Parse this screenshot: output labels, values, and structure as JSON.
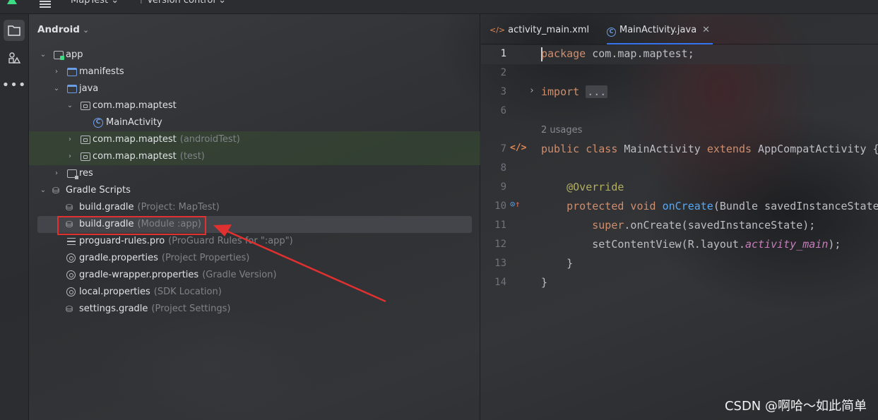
{
  "toolbar": {
    "project_name": "MapTest",
    "vcs_label": "Version control"
  },
  "project_panel": {
    "view_label": "Android",
    "tree": [
      {
        "label": "app",
        "hint": ""
      },
      {
        "label": "manifests",
        "hint": ""
      },
      {
        "label": "java",
        "hint": ""
      },
      {
        "label": "com.map.maptest",
        "hint": ""
      },
      {
        "label": "MainActivity",
        "hint": ""
      },
      {
        "label": "com.map.maptest",
        "hint": "(androidTest)"
      },
      {
        "label": "com.map.maptest",
        "hint": "(test)"
      },
      {
        "label": "res",
        "hint": ""
      },
      {
        "label": "Gradle Scripts",
        "hint": ""
      },
      {
        "label": "build.gradle",
        "hint": "(Project: MapTest)"
      },
      {
        "label": "build.gradle",
        "hint": "(Module :app)"
      },
      {
        "label": "proguard-rules.pro",
        "hint": "(ProGuard Rules for \":app\")"
      },
      {
        "label": "gradle.properties",
        "hint": "(Project Properties)"
      },
      {
        "label": "gradle-wrapper.properties",
        "hint": "(Gradle Version)"
      },
      {
        "label": "local.properties",
        "hint": "(SDK Location)"
      },
      {
        "label": "settings.gradle",
        "hint": "(Project Settings)"
      }
    ]
  },
  "editor": {
    "tabs": [
      {
        "label": "activity_main.xml"
      },
      {
        "label": "MainActivity.java"
      }
    ],
    "line_numbers": [
      "1",
      "2",
      "3",
      "6",
      "7",
      "8",
      "9",
      "10",
      "11",
      "12",
      "13",
      "14"
    ],
    "usages": "2 usages",
    "code": {
      "l1_kw": "package",
      "l1_rest": " com.map.maptest;",
      "l3_kw": "import",
      "l3_fold": "...",
      "l7_kw1": "public class",
      "l7_name": " MainActivity ",
      "l7_kw2": "extends",
      "l7_rest": " AppCompatActivity {",
      "l9_ann": "@Override",
      "l10_kw": "protected void ",
      "l10_fn": "onCreate",
      "l10_rest": "(Bundle savedInstanceState) {",
      "l11_kw": "super",
      "l11_rest": ".onCreate(savedInstanceState);",
      "l12_a": "setContentView(R.layout.",
      "l12_it": "activity_main",
      "l12_b": ");",
      "l13": "}",
      "l14": "}"
    }
  },
  "watermark": "CSDN @啊哈～如此简单",
  "colors": {
    "accent": "#3574f0",
    "callout": "#e0302f",
    "keyword": "#cf8e6d",
    "annotation": "#b3ae60",
    "function": "#56a8f5"
  }
}
